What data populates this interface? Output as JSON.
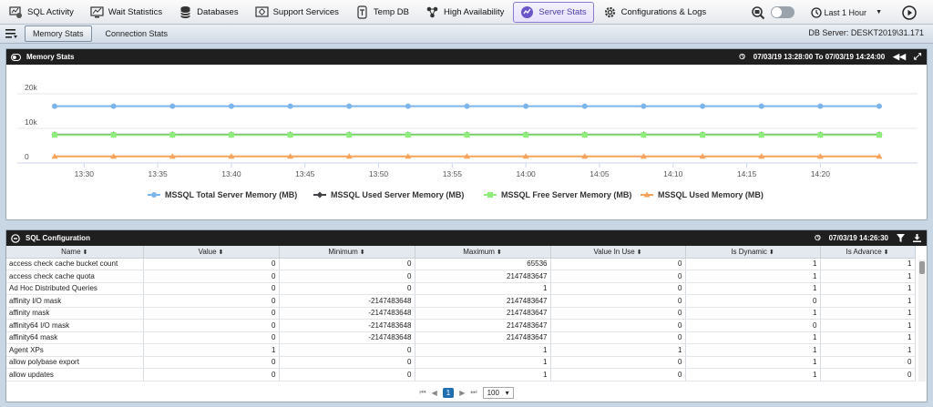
{
  "nav": {
    "items": [
      {
        "label": "SQL Activity",
        "icon": "activity-icon"
      },
      {
        "label": "Wait Statistics",
        "icon": "wait-stats-icon"
      },
      {
        "label": "Databases",
        "icon": "database-icon"
      },
      {
        "label": "Support Services",
        "icon": "support-services-icon"
      },
      {
        "label": "Temp DB",
        "icon": "tempdb-icon"
      },
      {
        "label": "High Availability",
        "icon": "high-availability-icon"
      },
      {
        "label": "Server Stats",
        "icon": "server-stats-icon"
      },
      {
        "label": "Configurations & Logs",
        "icon": "gear-icon"
      }
    ],
    "active": "Server Stats",
    "time_range": "Last 1 Hour"
  },
  "subnav": {
    "tabs": [
      "Memory Stats",
      "Connection Stats"
    ],
    "db_server": "DB Server: DESKT2019\\31.171"
  },
  "memory_panel": {
    "title": "Memory Stats",
    "range": "07/03/19 13:28:00 To 07/03/19 14:24:00"
  },
  "chart_data": {
    "type": "line",
    "x": [
      "13:28",
      "13:32",
      "13:36",
      "13:40",
      "13:44",
      "13:48",
      "13:52",
      "13:56",
      "14:00",
      "14:04",
      "14:08",
      "14:12",
      "14:16",
      "14:20",
      "14:24"
    ],
    "xticks": [
      "13:30",
      "13:35",
      "13:40",
      "13:45",
      "13:50",
      "13:55",
      "14:00",
      "14:05",
      "14:10",
      "14:15",
      "14:20"
    ],
    "yticks": [
      "0",
      "10k",
      "20k"
    ],
    "ylim": [
      0,
      20000
    ],
    "series": [
      {
        "name": "MSSQL Total Server Memory (MB)",
        "color": "#7cb5ec",
        "marker": "circle",
        "values": [
          16400,
          16400,
          16400,
          16400,
          16400,
          16400,
          16400,
          16400,
          16400,
          16400,
          16400,
          16400,
          16400,
          16400,
          16400
        ]
      },
      {
        "name": "MSSQL Used Server Memory (MB)",
        "color": "#434348",
        "marker": "diamond",
        "values": [
          8200,
          8200,
          8200,
          8200,
          8200,
          8200,
          8200,
          8200,
          8200,
          8200,
          8200,
          8200,
          8200,
          8200,
          8200
        ]
      },
      {
        "name": "MSSQL Free Server Memory (MB)",
        "color": "#90ed7d",
        "marker": "square",
        "values": [
          8100,
          8100,
          8100,
          8100,
          8100,
          8100,
          8100,
          8100,
          8100,
          8100,
          8100,
          8100,
          8100,
          8100,
          8100
        ]
      },
      {
        "name": "MSSQL Used Memory (MB)",
        "color": "#f7a35c",
        "marker": "triangle",
        "values": [
          1900,
          1900,
          1900,
          1900,
          1900,
          1900,
          1900,
          1900,
          1900,
          1900,
          1900,
          1900,
          1900,
          1900,
          1900
        ]
      }
    ]
  },
  "config_panel": {
    "title": "SQL Configuration",
    "timestamp": "07/03/19 14:26:30",
    "columns": [
      "Name",
      "Value",
      "Minimum",
      "Maximum",
      "Value In Use",
      "Is Dynamic",
      "Is Advance"
    ],
    "rows": [
      [
        "access check cache bucket count",
        "0",
        "0",
        "65536",
        "0",
        "1",
        "1"
      ],
      [
        "access check cache quota",
        "0",
        "0",
        "2147483647",
        "0",
        "1",
        "1"
      ],
      [
        "Ad Hoc Distributed Queries",
        "0",
        "0",
        "1",
        "0",
        "1",
        "1"
      ],
      [
        "affinity I/O mask",
        "0",
        "-2147483648",
        "2147483647",
        "0",
        "0",
        "1"
      ],
      [
        "affinity mask",
        "0",
        "-2147483648",
        "2147483647",
        "0",
        "1",
        "1"
      ],
      [
        "affinity64 I/O mask",
        "0",
        "-2147483648",
        "2147483647",
        "0",
        "0",
        "1"
      ],
      [
        "affinity64 mask",
        "0",
        "-2147483648",
        "2147483647",
        "0",
        "1",
        "1"
      ],
      [
        "Agent XPs",
        "1",
        "0",
        "1",
        "1",
        "1",
        "1"
      ],
      [
        "allow polybase export",
        "0",
        "0",
        "1",
        "0",
        "1",
        "0"
      ],
      [
        "allow updates",
        "0",
        "0",
        "1",
        "0",
        "1",
        "0"
      ]
    ],
    "pager": {
      "current": "1",
      "page_size": "100"
    }
  }
}
